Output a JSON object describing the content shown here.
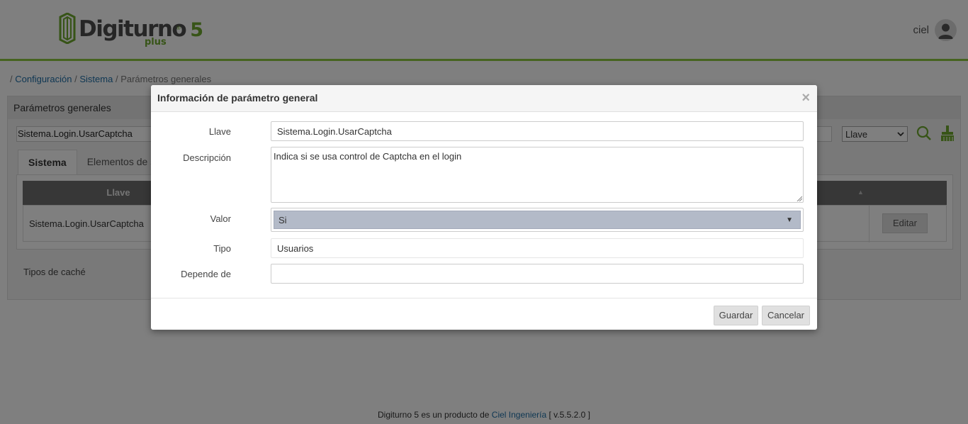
{
  "header": {
    "logo": {
      "wordmark": "Digiturno",
      "version": "5",
      "edition": "plus",
      "reg": "®"
    },
    "user": {
      "name": "ciel"
    }
  },
  "breadcrumb": {
    "separator": "/",
    "items": [
      "Configuración",
      "Sistema",
      "Parámetros generales"
    ]
  },
  "panel": {
    "title": "Parámetros generales",
    "search_value": "Sistema.Login.UsarCaptcha",
    "filter_select": "Llave",
    "tabs": [
      "Sistema",
      "Elementos de s"
    ],
    "grid": {
      "columns": [
        "Llave"
      ],
      "rows": [
        {
          "llave": "Sistema.Login.UsarCaptcha",
          "action": "Editar"
        }
      ]
    },
    "cache_label": "Tipos de caché"
  },
  "modal": {
    "title": "Información de parámetro general",
    "close_glyph": "×",
    "fields": {
      "llave": {
        "label": "Llave",
        "value": "Sistema.Login.UsarCaptcha"
      },
      "descripcion": {
        "label": "Descripción",
        "value": "Indica si se usa control de Captcha en el login"
      },
      "valor": {
        "label": "Valor",
        "value": "Si"
      },
      "tipo": {
        "label": "Tipo",
        "value": "Usuarios"
      },
      "depende": {
        "label": "Depende de",
        "value": ""
      }
    },
    "buttons": {
      "save": "Guardar",
      "cancel": "Cancelar"
    }
  },
  "footer": {
    "text_before": "Digiturno 5 es un producto de",
    "company": "Ciel Ingeniería",
    "version": "[ v.5.5.2.0 ]"
  },
  "colors": {
    "brand_green": "#6ea82e",
    "accent_line": "#8dc63f",
    "link": "#1f6fa7",
    "select_highlight": "#b3bac8"
  }
}
